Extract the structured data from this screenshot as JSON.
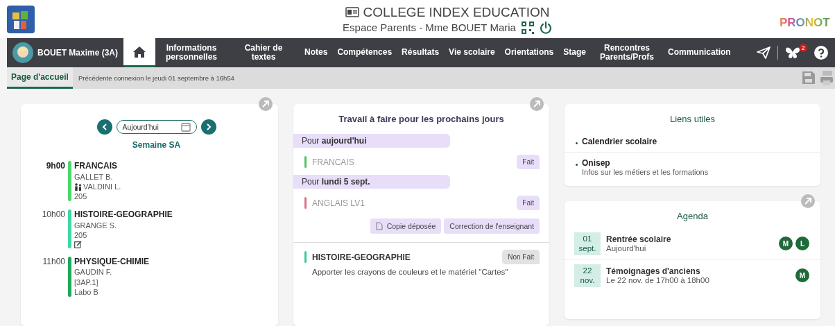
{
  "header": {
    "school": "COLLEGE INDEX EDUCATION",
    "space": "Espace Parents - Mme BOUET Maria",
    "brand": "PRONOT"
  },
  "student": {
    "name": "BOUET Maxime (3A)"
  },
  "nav": [
    {
      "kind": "home",
      "selected": true
    },
    {
      "kind": "text",
      "label": "Informations personnelles",
      "selected": false
    },
    {
      "kind": "text",
      "label": "Cahier de textes",
      "selected": false
    },
    {
      "kind": "text",
      "label": "Notes",
      "selected": false
    },
    {
      "kind": "text",
      "label": "Compétences",
      "selected": false
    },
    {
      "kind": "text",
      "label": "Résultats",
      "selected": false
    },
    {
      "kind": "text",
      "label": "Vie scolaire",
      "selected": false
    },
    {
      "kind": "text",
      "label": "Orientations",
      "selected": false
    },
    {
      "kind": "text",
      "label": "Stage",
      "selected": false
    },
    {
      "kind": "text",
      "label": "Rencontres Parents/Profs",
      "selected": false
    },
    {
      "kind": "text",
      "label": "Communication",
      "selected": false
    }
  ],
  "notification_count": "2",
  "subbar": {
    "tab": {
      "label": "Page d'accueil",
      "selected": true
    },
    "last_login": "Précédente connexion le jeudi 01 septembre à 16h54"
  },
  "timetable": {
    "date": "Aujourd'hui",
    "week": "Semaine SA",
    "lessons": [
      {
        "time": "9h00",
        "current": true,
        "color": "#4cd66a",
        "subject": "FRANCAIS",
        "lines": [
          {
            "kind": "text",
            "text": "GALLET B."
          },
          {
            "kind": "assistant",
            "text": "VALDINI L."
          },
          {
            "kind": "text",
            "text": "205"
          }
        ]
      },
      {
        "time": "10h00",
        "current": false,
        "color": "#3ed8a0",
        "subject": "HISTOIRE-GEOGRAPHIE",
        "lines": [
          {
            "kind": "text",
            "text": "GRANGE S."
          },
          {
            "kind": "text",
            "text": "205"
          },
          {
            "kind": "homework"
          }
        ]
      },
      {
        "time": "11h00",
        "current": false,
        "color": "#1fa85a",
        "subject": "PHYSIQUE-CHIMIE",
        "lines": [
          {
            "kind": "text",
            "text": "GAUDIN F."
          },
          {
            "kind": "text",
            "text": "[3AP.1]"
          },
          {
            "kind": "text",
            "text": "Labo B"
          }
        ]
      }
    ]
  },
  "homework": {
    "title": "Travail à faire pour les prochains jours",
    "groups": [
      {
        "label": "Pour **aujourd'hui**",
        "items": [
          {
            "subject": "FRANCAIS",
            "color": "#4cc466",
            "done": true,
            "status": "Fait"
          }
        ]
      },
      {
        "label": "Pour **lundi 5 sept.**",
        "items": [
          {
            "subject": "ANGLAIS LV1",
            "color": "#e07088",
            "done": true,
            "status": "Fait",
            "attachments": [
              {
                "kind": "pdf",
                "label": "Copie déposée"
              },
              {
                "kind": "text",
                "label": "Correction de l'enseignant"
              }
            ]
          },
          {
            "subject": "HISTOIRE-GEOGRAPHIE",
            "color": "#3ec8a0",
            "done": false,
            "status": "Non Fait",
            "description": "Apporter les crayons de couleurs et le matériel \"Cartes\""
          }
        ]
      }
    ]
  },
  "links": {
    "title": "Liens utiles",
    "items": [
      {
        "label": "Calendrier scolaire"
      },
      {
        "label": "Onisep",
        "description": "Infos sur les métiers et les formations"
      }
    ]
  },
  "agenda": {
    "title": "Agenda",
    "events": [
      {
        "day": "01",
        "month": "sept.",
        "title": "Rentrée scolaire",
        "subtitle": "Aujourd'hui",
        "tags": [
          "M",
          "L"
        ]
      },
      {
        "day": "22",
        "month": "nov.",
        "title": "Témoignages d'anciens",
        "subtitle": "Le 22 nov. de 17h00 à 18h00",
        "tags": [
          "M"
        ]
      }
    ]
  }
}
